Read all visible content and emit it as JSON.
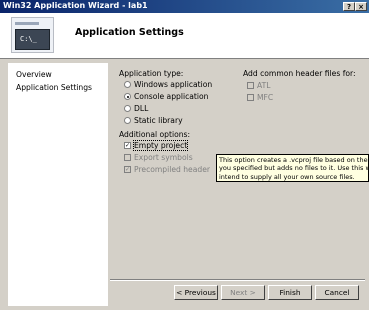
{
  "window": {
    "title": "Win32 Application Wizard - lab1",
    "help_label": "?",
    "close_label": "×"
  },
  "header": {
    "heading": "Application Settings",
    "banner_prompt": "C:\\_"
  },
  "nav": {
    "items": [
      {
        "label": "Overview"
      },
      {
        "label": "Application Settings"
      }
    ]
  },
  "app_type": {
    "label": "Application type:",
    "options": [
      {
        "label": "Windows application",
        "checked": false
      },
      {
        "label": "Console application",
        "checked": true
      },
      {
        "label": "DLL",
        "checked": false
      },
      {
        "label": "Static library",
        "checked": false
      }
    ]
  },
  "additional": {
    "label": "Additional options:",
    "options": [
      {
        "label": "Empty project",
        "checked": true,
        "enabled": true
      },
      {
        "label": "Export symbols",
        "checked": false,
        "enabled": false
      },
      {
        "label": "Precompiled header",
        "checked": true,
        "enabled": false
      }
    ]
  },
  "headers": {
    "label": "Add common header files for:",
    "options": [
      {
        "label": "ATL",
        "checked": false,
        "enabled": false
      },
      {
        "label": "MFC",
        "checked": false,
        "enabled": false
      }
    ]
  },
  "tooltip": {
    "lines": [
      "This option creates a .vcproj file based on the project",
      "you specified but adds no files to it. Use this when y",
      "intend to supply all your own source files."
    ]
  },
  "buttons": {
    "previous": "< Previous",
    "next": "Next >",
    "finish": "Finish",
    "cancel": "Cancel"
  }
}
